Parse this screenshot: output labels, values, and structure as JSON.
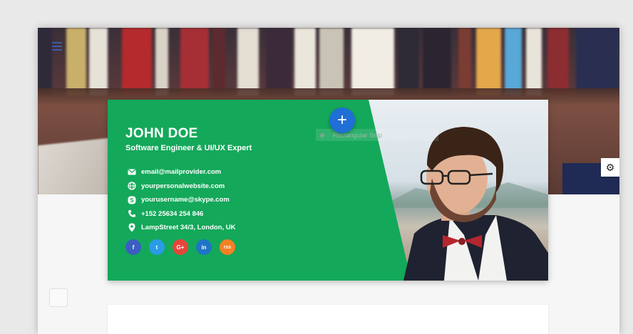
{
  "profile": {
    "name": "JOHN DOE",
    "title": "Software Engineer & UI/UX Expert"
  },
  "contacts": {
    "email": "email@mailprovider.com",
    "website": "yourpersonalwebsite.com",
    "skype": "yourusername@skype.com",
    "phone": "+152 25634 254 846",
    "address": "LampStreet 34/3, London, UK"
  },
  "socials": {
    "facebook": "f",
    "twitter": "t",
    "googleplus": "G+",
    "linkedin": "in",
    "rss": "rss"
  },
  "overlay": {
    "snip_label": "Rectangular Snip"
  },
  "colors": {
    "card_green": "#14a85a",
    "accent_blue": "#1f6fd6",
    "facebook": "#3b5ec2",
    "twitter": "#2a9be6",
    "googleplus": "#e8453c",
    "linkedin": "#1e74c4",
    "rss": "#f58024"
  }
}
